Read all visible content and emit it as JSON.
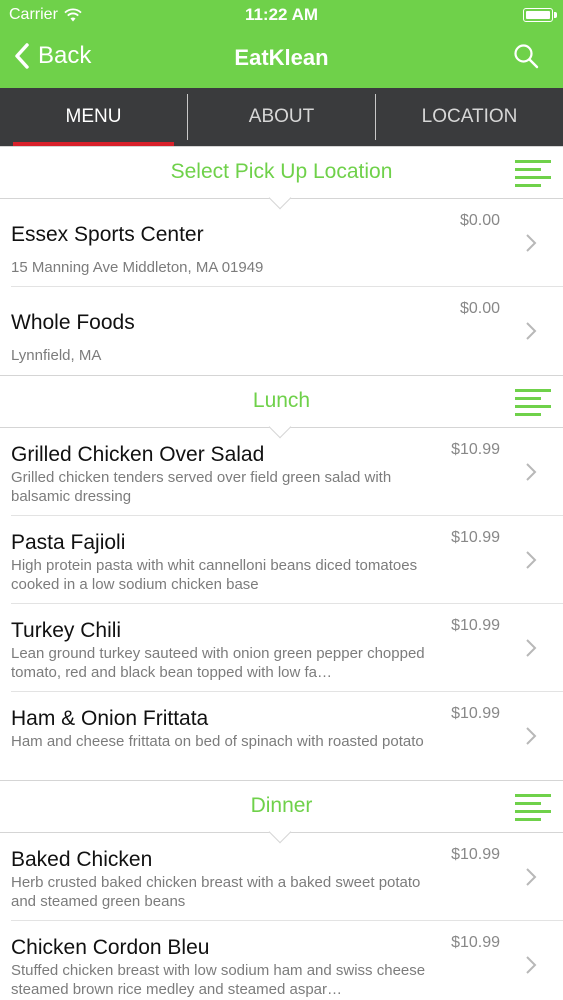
{
  "status": {
    "carrier": "Carrier",
    "time": "11:22 AM"
  },
  "nav": {
    "back_label": "Back",
    "title": "EatKlean"
  },
  "tabs": [
    {
      "label": "MENU",
      "active": true
    },
    {
      "label": "ABOUT",
      "active": false
    },
    {
      "label": "LOCATION",
      "active": false
    }
  ],
  "sections": {
    "pickup": {
      "title": "Select Pick Up Location",
      "locations": [
        {
          "name": "Essex Sports Center",
          "address": "15 Manning Ave Middleton, MA 01949",
          "price": "$0.00"
        },
        {
          "name": "Whole Foods",
          "address": "Lynnfield, MA",
          "price": "$0.00"
        }
      ]
    },
    "lunch": {
      "title": "Lunch",
      "items": [
        {
          "name": "Grilled Chicken Over Salad",
          "desc": "Grilled chicken tenders served over field green salad with balsamic dressing",
          "price": "$10.99"
        },
        {
          "name": "Pasta Fajioli",
          "desc": "High protein pasta with whit cannelloni beans diced tomatoes cooked in a low sodium chicken base",
          "price": "$10.99"
        },
        {
          "name": "Turkey Chili",
          "desc": "Lean ground turkey sauteed with onion green pepper chopped tomato, red and black bean topped with low fa…",
          "price": "$10.99"
        },
        {
          "name": "Ham & Onion Frittata",
          "desc": "Ham and cheese frittata on bed of spinach with roasted potato",
          "price": "$10.99"
        }
      ]
    },
    "dinner": {
      "title": "Dinner",
      "items": [
        {
          "name": "Baked Chicken",
          "desc": "Herb crusted baked chicken breast with a baked sweet potato and steamed green beans",
          "price": "$10.99"
        },
        {
          "name": "Chicken Cordon Bleu",
          "desc": "Stuffed chicken breast with low sodium ham and swiss cheese steamed brown rice medley and steamed aspar…",
          "price": "$10.99"
        }
      ]
    }
  },
  "colors": {
    "brand_green": "#6fd14a",
    "tab_bar": "#3a3b3d",
    "active_tab_indicator": "#d8202a"
  },
  "icons": [
    "wifi-icon",
    "battery-icon",
    "back-chevron-icon",
    "search-icon",
    "list-menu-icon",
    "chevron-right-icon"
  ]
}
